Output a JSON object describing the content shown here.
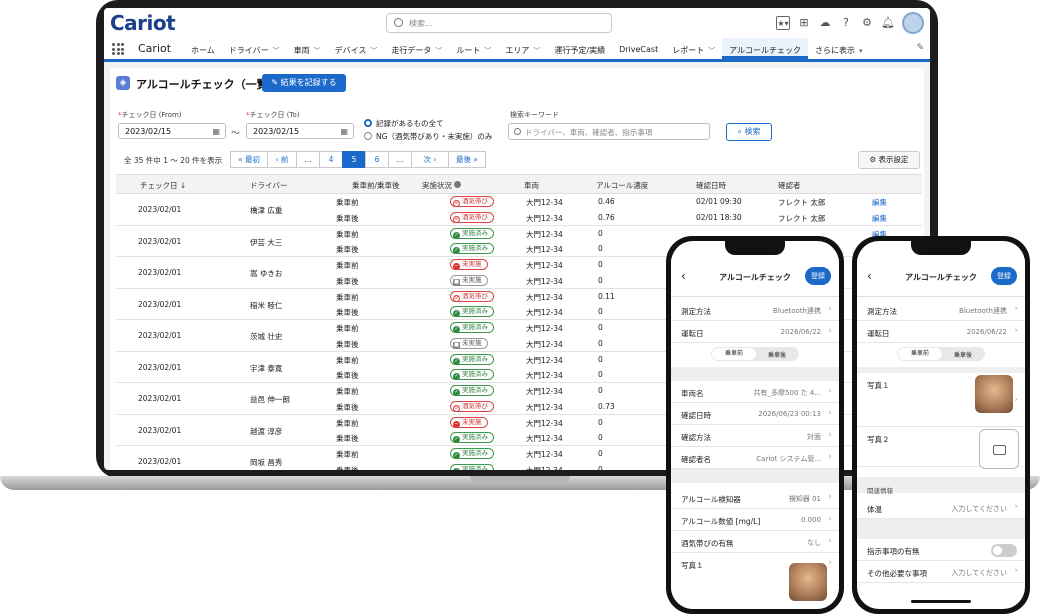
{
  "header": {
    "logo": "Cariot",
    "search_placeholder": "検索..."
  },
  "nav": {
    "app_name": "Cariot",
    "items": [
      {
        "label": "ホーム",
        "chev": ""
      },
      {
        "label": "ドライバー",
        "chev": "﹀"
      },
      {
        "label": "車両",
        "chev": "﹀"
      },
      {
        "label": "デバイス",
        "chev": "﹀"
      },
      {
        "label": "走行データ",
        "chev": "﹀"
      },
      {
        "label": "ルート",
        "chev": "﹀"
      },
      {
        "label": "エリア",
        "chev": "﹀"
      },
      {
        "label": "運行予定/実績",
        "chev": ""
      },
      {
        "label": "DriveCast",
        "chev": ""
      },
      {
        "label": "レポート",
        "chev": "﹀"
      },
      {
        "label": "アルコールチェック",
        "chev": ""
      },
      {
        "label": "さらに表示",
        "chev": "▾"
      }
    ]
  },
  "page": {
    "title": "アルコールチェック（一覧）",
    "record_button": "結果を記録する",
    "date_from_label": "チェック日 (From)",
    "date_to_label": "チェック日 (To)",
    "date_from": "2023/02/15",
    "date_to": "2023/02/15",
    "tilde": "〜",
    "radio_all": "記録があるもの全て",
    "radio_ng": "NG（酒気帯びあり・未実施）のみ",
    "keyword_label": "検索キーワード",
    "keyword_placeholder": "ドライバー、車両、確認者、指示事項",
    "search_button": "検索",
    "count_text": "全 35 件中 1 〜 20 件を表示",
    "pager": [
      "« 最初",
      "‹ 前",
      "...",
      "4",
      "5",
      "6",
      "...",
      "次 ›",
      "最後 »"
    ],
    "view_settings": "表示設定"
  },
  "table": {
    "headers": [
      "チェック日 ↓",
      "ドライバー",
      "乗車前/乗車後",
      "実施状況",
      "車両",
      "アルコール濃度",
      "確認日時",
      "確認者"
    ],
    "edit_label": "編集",
    "groups": [
      {
        "date": "2023/02/01",
        "driver": "橋津 広重",
        "rows": [
          {
            "phase": "乗車前",
            "status": "酒気帯び",
            "kind": "red",
            "vehicle": "大門12-34",
            "alc": "0.46",
            "time": "02/01 09:30",
            "checker": "フレクト 太郎",
            "edit": true
          },
          {
            "phase": "乗車後",
            "status": "酒気帯び",
            "kind": "red",
            "vehicle": "大門12-34",
            "alc": "0.76",
            "time": "02/01 18:30",
            "checker": "フレクト 太郎",
            "edit": true
          }
        ]
      },
      {
        "date": "2023/02/01",
        "driver": "伊芸 大三",
        "rows": [
          {
            "phase": "乗車前",
            "status": "実施済み",
            "kind": "green",
            "vehicle": "大門12-34",
            "alc": "0",
            "time": "",
            "checker": "",
            "edit": true
          },
          {
            "phase": "乗車後",
            "status": "実施済み",
            "kind": "green",
            "vehicle": "大門12-34",
            "alc": "0",
            "time": "",
            "checker": "",
            "edit": false
          }
        ]
      },
      {
        "date": "2023/02/01",
        "driver": "嵩 ゆきお",
        "rows": [
          {
            "phase": "乗車前",
            "status": "未実施",
            "kind": "none",
            "vehicle": "大門12-34",
            "alc": "0",
            "time": "",
            "checker": "",
            "edit": false
          },
          {
            "phase": "乗車後",
            "status": "未実施",
            "kind": "gray",
            "vehicle": "大門12-34",
            "alc": "0",
            "time": "",
            "checker": "",
            "edit": false
          }
        ]
      },
      {
        "date": "2023/02/01",
        "driver": "稲米 睦仁",
        "rows": [
          {
            "phase": "乗車前",
            "status": "酒気帯び",
            "kind": "red",
            "vehicle": "大門12-34",
            "alc": "0.11",
            "time": "",
            "checker": "",
            "edit": false
          },
          {
            "phase": "乗車後",
            "status": "実施済み",
            "kind": "green",
            "vehicle": "大門12-34",
            "alc": "0",
            "time": "",
            "checker": "",
            "edit": false
          }
        ]
      },
      {
        "date": "2023/02/01",
        "driver": "茨城 壮史",
        "rows": [
          {
            "phase": "乗車前",
            "status": "実施済み",
            "kind": "green",
            "vehicle": "大門12-34",
            "alc": "0",
            "time": "",
            "checker": "",
            "edit": false
          },
          {
            "phase": "乗車後",
            "status": "未実施",
            "kind": "gray",
            "vehicle": "大門12-34",
            "alc": "0",
            "time": "",
            "checker": "",
            "edit": false
          }
        ]
      },
      {
        "date": "2023/02/01",
        "driver": "宇津 泰寛",
        "rows": [
          {
            "phase": "乗車前",
            "status": "実施済み",
            "kind": "green",
            "vehicle": "大門12-34",
            "alc": "0",
            "time": "",
            "checker": "",
            "edit": false
          },
          {
            "phase": "乗車後",
            "status": "実施済み",
            "kind": "green",
            "vehicle": "大門12-34",
            "alc": "0",
            "time": "",
            "checker": "",
            "edit": false
          }
        ]
      },
      {
        "date": "2023/02/01",
        "driver": "益邑 伸一朗",
        "rows": [
          {
            "phase": "乗車前",
            "status": "実施済み",
            "kind": "green",
            "vehicle": "大門12-34",
            "alc": "0",
            "time": "",
            "checker": "",
            "edit": false
          },
          {
            "phase": "乗車後",
            "status": "酒気帯び",
            "kind": "red",
            "vehicle": "大門12-34",
            "alc": "0.73",
            "time": "",
            "checker": "",
            "edit": false
          }
        ]
      },
      {
        "date": "2023/02/01",
        "driver": "越渡 淳彦",
        "rows": [
          {
            "phase": "乗車前",
            "status": "未実施",
            "kind": "none",
            "vehicle": "大門12-34",
            "alc": "0",
            "time": "",
            "checker": "",
            "edit": false
          },
          {
            "phase": "乗車後",
            "status": "実施済み",
            "kind": "green",
            "vehicle": "大門12-34",
            "alc": "0",
            "time": "",
            "checker": "",
            "edit": false
          }
        ]
      },
      {
        "date": "2023/02/01",
        "driver": "岡坂 昌秀",
        "rows": [
          {
            "phase": "乗車前",
            "status": "実施済み",
            "kind": "green",
            "vehicle": "大門12-34",
            "alc": "0",
            "time": "",
            "checker": "",
            "edit": false
          },
          {
            "phase": "乗車後",
            "status": "実施済み",
            "kind": "green",
            "vehicle": "大門12-34",
            "alc": "0",
            "time": "",
            "checker": "",
            "edit": false
          }
        ]
      }
    ]
  },
  "phone1": {
    "title": "アルコールチェック",
    "register": "登録",
    "rows_a": [
      {
        "k": "測定方法",
        "v": "Bluetooth連携"
      },
      {
        "k": "運転日",
        "v": "2026/06/22"
      }
    ],
    "seg_on": "乗車前",
    "seg_off": "乗車後",
    "rows_b": [
      {
        "k": "車両名",
        "v": "共有_多摩500 た 4..."
      },
      {
        "k": "確認日時",
        "v": "2026/06/23 00:13"
      },
      {
        "k": "確認方法",
        "v": "対面"
      },
      {
        "k": "確認者名",
        "v": "Cariot システム管..."
      }
    ],
    "rows_c": [
      {
        "k": "アルコール検知器",
        "v": "検知器 01"
      },
      {
        "k": "アルコール数値 [mg/L]",
        "v": "0.000"
      },
      {
        "k": "酒気帯びの有無",
        "v": "なし"
      },
      {
        "k": "写真１",
        "v": ""
      }
    ]
  },
  "phone2": {
    "title": "アルコールチェック",
    "register": "登録",
    "rows_a": [
      {
        "k": "測定方法",
        "v": "Bluetooth連携"
      },
      {
        "k": "運転日",
        "v": "2026/06/22"
      }
    ],
    "seg_on": "乗車前",
    "seg_off": "乗車後",
    "photo1": "写真１",
    "photo2": "写真２",
    "section": "関連情報",
    "temp": {
      "k": "体温",
      "v": "入力してください"
    },
    "instr": {
      "k": "指示事項の有無"
    },
    "other": {
      "k": "その他必要な事項",
      "v": "入力してください"
    }
  }
}
